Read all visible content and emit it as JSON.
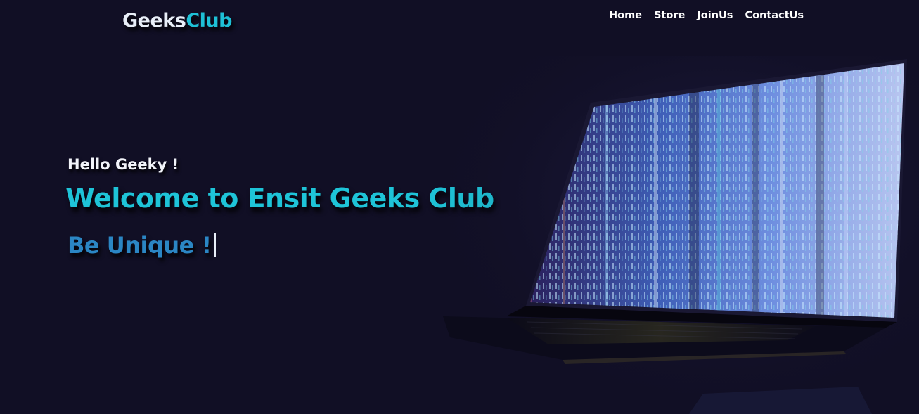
{
  "header": {
    "logo_part1": "Geeks",
    "logo_part2": "Club",
    "nav": [
      {
        "label": "Home"
      },
      {
        "label": "Store"
      },
      {
        "label": "JoinUs"
      },
      {
        "label": "ContactUs"
      }
    ]
  },
  "hero": {
    "greeting": "Hello Geeky !",
    "title": "Welcome to Ensit Geeks Club",
    "typed_text": "Be Unique !"
  },
  "colors": {
    "background": "#110f25",
    "accent": "#1ec4d8",
    "accent_secondary": "#2b86c4",
    "text": "#ffffff"
  },
  "icons": {
    "hero_image": "laptop-matrix-image"
  }
}
